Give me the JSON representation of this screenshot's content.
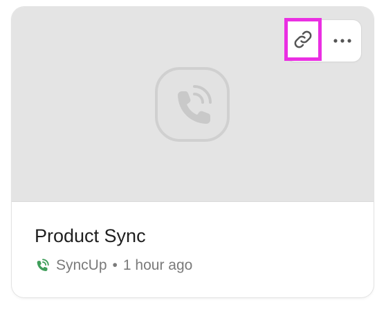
{
  "card": {
    "title": "Product Sync",
    "app_name": "SyncUp",
    "separator": "•",
    "time_ago": "1 hour ago",
    "thumbnail_icon": "phone-call-icon",
    "app_icon": "phone-call-icon",
    "app_icon_color": "#3f9e5a"
  },
  "actions": {
    "copy_link_icon": "link-icon",
    "more_icon": "more-horizontal-icon",
    "highlight_color": "#ea2fe2"
  }
}
